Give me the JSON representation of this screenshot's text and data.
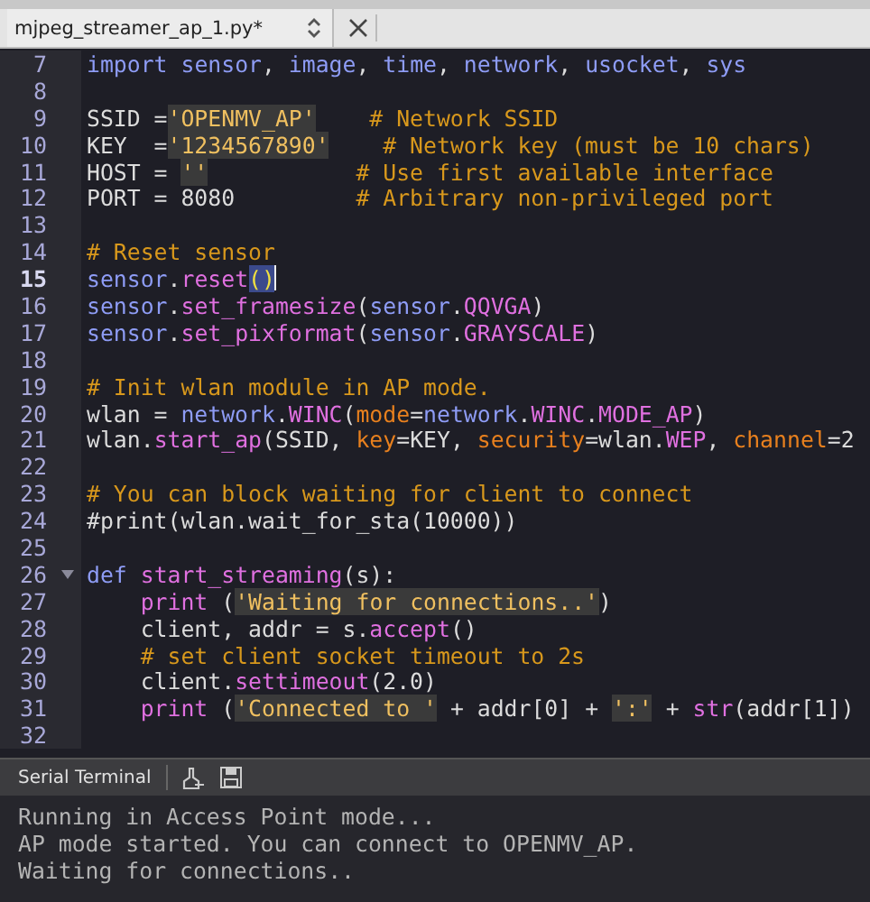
{
  "editor_tab": {
    "title": "mjpeg_streamer_ap_1.py*"
  },
  "code_lines": [
    {
      "number": "7",
      "current": false,
      "fold": false,
      "tokens": [
        {
          "kind": "keyword",
          "text": "import"
        },
        {
          "kind": "name",
          "text": " sensor"
        },
        {
          "kind": "plain",
          "text": ", "
        },
        {
          "kind": "name",
          "text": "image"
        },
        {
          "kind": "plain",
          "text": ", "
        },
        {
          "kind": "name",
          "text": "time"
        },
        {
          "kind": "plain",
          "text": ", "
        },
        {
          "kind": "name",
          "text": "network"
        },
        {
          "kind": "plain",
          "text": ", "
        },
        {
          "kind": "name",
          "text": "usocket"
        },
        {
          "kind": "plain",
          "text": ", "
        },
        {
          "kind": "name",
          "text": "sys"
        }
      ]
    },
    {
      "number": "8",
      "current": false,
      "fold": false
    },
    {
      "number": "9",
      "current": false,
      "fold": false,
      "tokens": [
        {
          "kind": "plain",
          "text": "SSID ="
        },
        {
          "kind": "string",
          "text": "'OPENMV_AP'"
        },
        {
          "kind": "comment",
          "text": "    # Network SSID"
        }
      ]
    },
    {
      "number": "10",
      "current": false,
      "fold": false,
      "tokens": [
        {
          "kind": "plain",
          "text": "KEY  ="
        },
        {
          "kind": "string",
          "text": "'1234567890'"
        },
        {
          "kind": "comment",
          "text": "    # Network key (must be 10 chars)"
        }
      ]
    },
    {
      "number": "11",
      "current": false,
      "fold": false,
      "tokens": [
        {
          "kind": "plain",
          "text": "HOST = "
        },
        {
          "kind": "string",
          "text": "''"
        },
        {
          "kind": "comment",
          "text": "           # Use first available interface"
        }
      ]
    },
    {
      "number": "12",
      "current": false,
      "fold": false,
      "tokens": [
        {
          "kind": "plain",
          "text": "PORT = 8080"
        },
        {
          "kind": "comment",
          "text": "         # Arbitrary non-privileged port"
        }
      ]
    },
    {
      "number": "13",
      "current": false,
      "fold": false
    },
    {
      "number": "14",
      "current": false,
      "fold": false,
      "tokens": [
        {
          "kind": "comment",
          "text": "# Reset sensor"
        }
      ]
    },
    {
      "number": "15",
      "current": true,
      "fold": false,
      "tokens": [
        {
          "kind": "name",
          "text": "sensor"
        },
        {
          "kind": "plain",
          "text": "."
        },
        {
          "kind": "function",
          "text": "reset"
        },
        {
          "kind": "bracket-match",
          "text": "()"
        }
      ]
    },
    {
      "number": "16",
      "current": false,
      "fold": false,
      "tokens": [
        {
          "kind": "name",
          "text": "sensor"
        },
        {
          "kind": "plain",
          "text": "."
        },
        {
          "kind": "function",
          "text": "set_framesize"
        },
        {
          "kind": "plain",
          "text": "("
        },
        {
          "kind": "name",
          "text": "sensor"
        },
        {
          "kind": "plain",
          "text": "."
        },
        {
          "kind": "function",
          "text": "QQVGA"
        },
        {
          "kind": "plain",
          "text": ")"
        }
      ]
    },
    {
      "number": "17",
      "current": false,
      "fold": false,
      "tokens": [
        {
          "kind": "name",
          "text": "sensor"
        },
        {
          "kind": "plain",
          "text": "."
        },
        {
          "kind": "function",
          "text": "set_pixformat"
        },
        {
          "kind": "plain",
          "text": "("
        },
        {
          "kind": "name",
          "text": "sensor"
        },
        {
          "kind": "plain",
          "text": "."
        },
        {
          "kind": "function",
          "text": "GRAYSCALE"
        },
        {
          "kind": "plain",
          "text": ")"
        }
      ]
    },
    {
      "number": "18",
      "current": false,
      "fold": false
    },
    {
      "number": "19",
      "current": false,
      "fold": false,
      "tokens": [
        {
          "kind": "comment",
          "text": "# Init wlan module in AP mode."
        }
      ]
    },
    {
      "number": "20",
      "current": false,
      "fold": false,
      "tokens": [
        {
          "kind": "plain",
          "text": "wlan = "
        },
        {
          "kind": "name",
          "text": "network"
        },
        {
          "kind": "plain",
          "text": "."
        },
        {
          "kind": "function",
          "text": "WINC"
        },
        {
          "kind": "plain",
          "text": "("
        },
        {
          "kind": "argument",
          "text": "mode"
        },
        {
          "kind": "plain",
          "text": "="
        },
        {
          "kind": "name",
          "text": "network"
        },
        {
          "kind": "plain",
          "text": "."
        },
        {
          "kind": "function",
          "text": "WINC"
        },
        {
          "kind": "plain",
          "text": "."
        },
        {
          "kind": "function",
          "text": "MODE_AP"
        },
        {
          "kind": "plain",
          "text": ")"
        }
      ]
    },
    {
      "number": "21",
      "current": false,
      "fold": false,
      "tokens": [
        {
          "kind": "plain",
          "text": "wlan."
        },
        {
          "kind": "function",
          "text": "start_ap"
        },
        {
          "kind": "plain",
          "text": "(SSID, "
        },
        {
          "kind": "argument",
          "text": "key"
        },
        {
          "kind": "plain",
          "text": "=KEY, "
        },
        {
          "kind": "argument",
          "text": "security"
        },
        {
          "kind": "plain",
          "text": "=wlan."
        },
        {
          "kind": "function",
          "text": "WEP"
        },
        {
          "kind": "plain",
          "text": ", "
        },
        {
          "kind": "argument",
          "text": "channel"
        },
        {
          "kind": "plain",
          "text": "=2"
        }
      ]
    },
    {
      "number": "22",
      "current": false,
      "fold": false
    },
    {
      "number": "23",
      "current": false,
      "fold": false,
      "tokens": [
        {
          "kind": "comment",
          "text": "# You can block waiting for client to connect"
        }
      ]
    },
    {
      "number": "24",
      "current": false,
      "fold": false,
      "tokens": [
        {
          "kind": "plain",
          "text": "#print(wlan.wait_for_sta(10000))"
        }
      ]
    },
    {
      "number": "25",
      "current": false,
      "fold": false
    },
    {
      "number": "26",
      "current": false,
      "fold": true,
      "tokens": [
        {
          "kind": "keyword",
          "text": "def"
        },
        {
          "kind": "function",
          "text": " start_streaming"
        },
        {
          "kind": "plain",
          "text": "(s):"
        }
      ]
    },
    {
      "number": "27",
      "current": false,
      "fold": false,
      "tokens": [
        {
          "kind": "function",
          "text": "    print"
        },
        {
          "kind": "plain",
          "text": " ("
        },
        {
          "kind": "string",
          "text": "'Waiting for connections..'"
        },
        {
          "kind": "plain",
          "text": ")"
        }
      ]
    },
    {
      "number": "28",
      "current": false,
      "fold": false,
      "tokens": [
        {
          "kind": "plain",
          "text": "    client, addr = s."
        },
        {
          "kind": "function",
          "text": "accept"
        },
        {
          "kind": "plain",
          "text": "()"
        }
      ]
    },
    {
      "number": "29",
      "current": false,
      "fold": false,
      "tokens": [
        {
          "kind": "comment",
          "text": "    # set client socket timeout to 2s"
        }
      ]
    },
    {
      "number": "30",
      "current": false,
      "fold": false,
      "tokens": [
        {
          "kind": "plain",
          "text": "    client."
        },
        {
          "kind": "function",
          "text": "settimeout"
        },
        {
          "kind": "plain",
          "text": "(2.0)"
        }
      ]
    },
    {
      "number": "31",
      "current": false,
      "fold": false,
      "tokens": [
        {
          "kind": "function",
          "text": "    print"
        },
        {
          "kind": "plain",
          "text": " ("
        },
        {
          "kind": "string",
          "text": "'Connected to '"
        },
        {
          "kind": "plain",
          "text": " + addr[0] + "
        },
        {
          "kind": "string",
          "text": "':'"
        },
        {
          "kind": "plain",
          "text": " + "
        },
        {
          "kind": "function",
          "text": "str"
        },
        {
          "kind": "plain",
          "text": "(addr[1])"
        }
      ]
    },
    {
      "number": "32",
      "current": false,
      "fold": false
    }
  ],
  "serial_terminal": {
    "title": "Serial Terminal",
    "output": [
      "Running in Access Point mode...",
      "AP mode started. You can connect to OPENMV_AP.",
      "Waiting for connections.."
    ]
  }
}
